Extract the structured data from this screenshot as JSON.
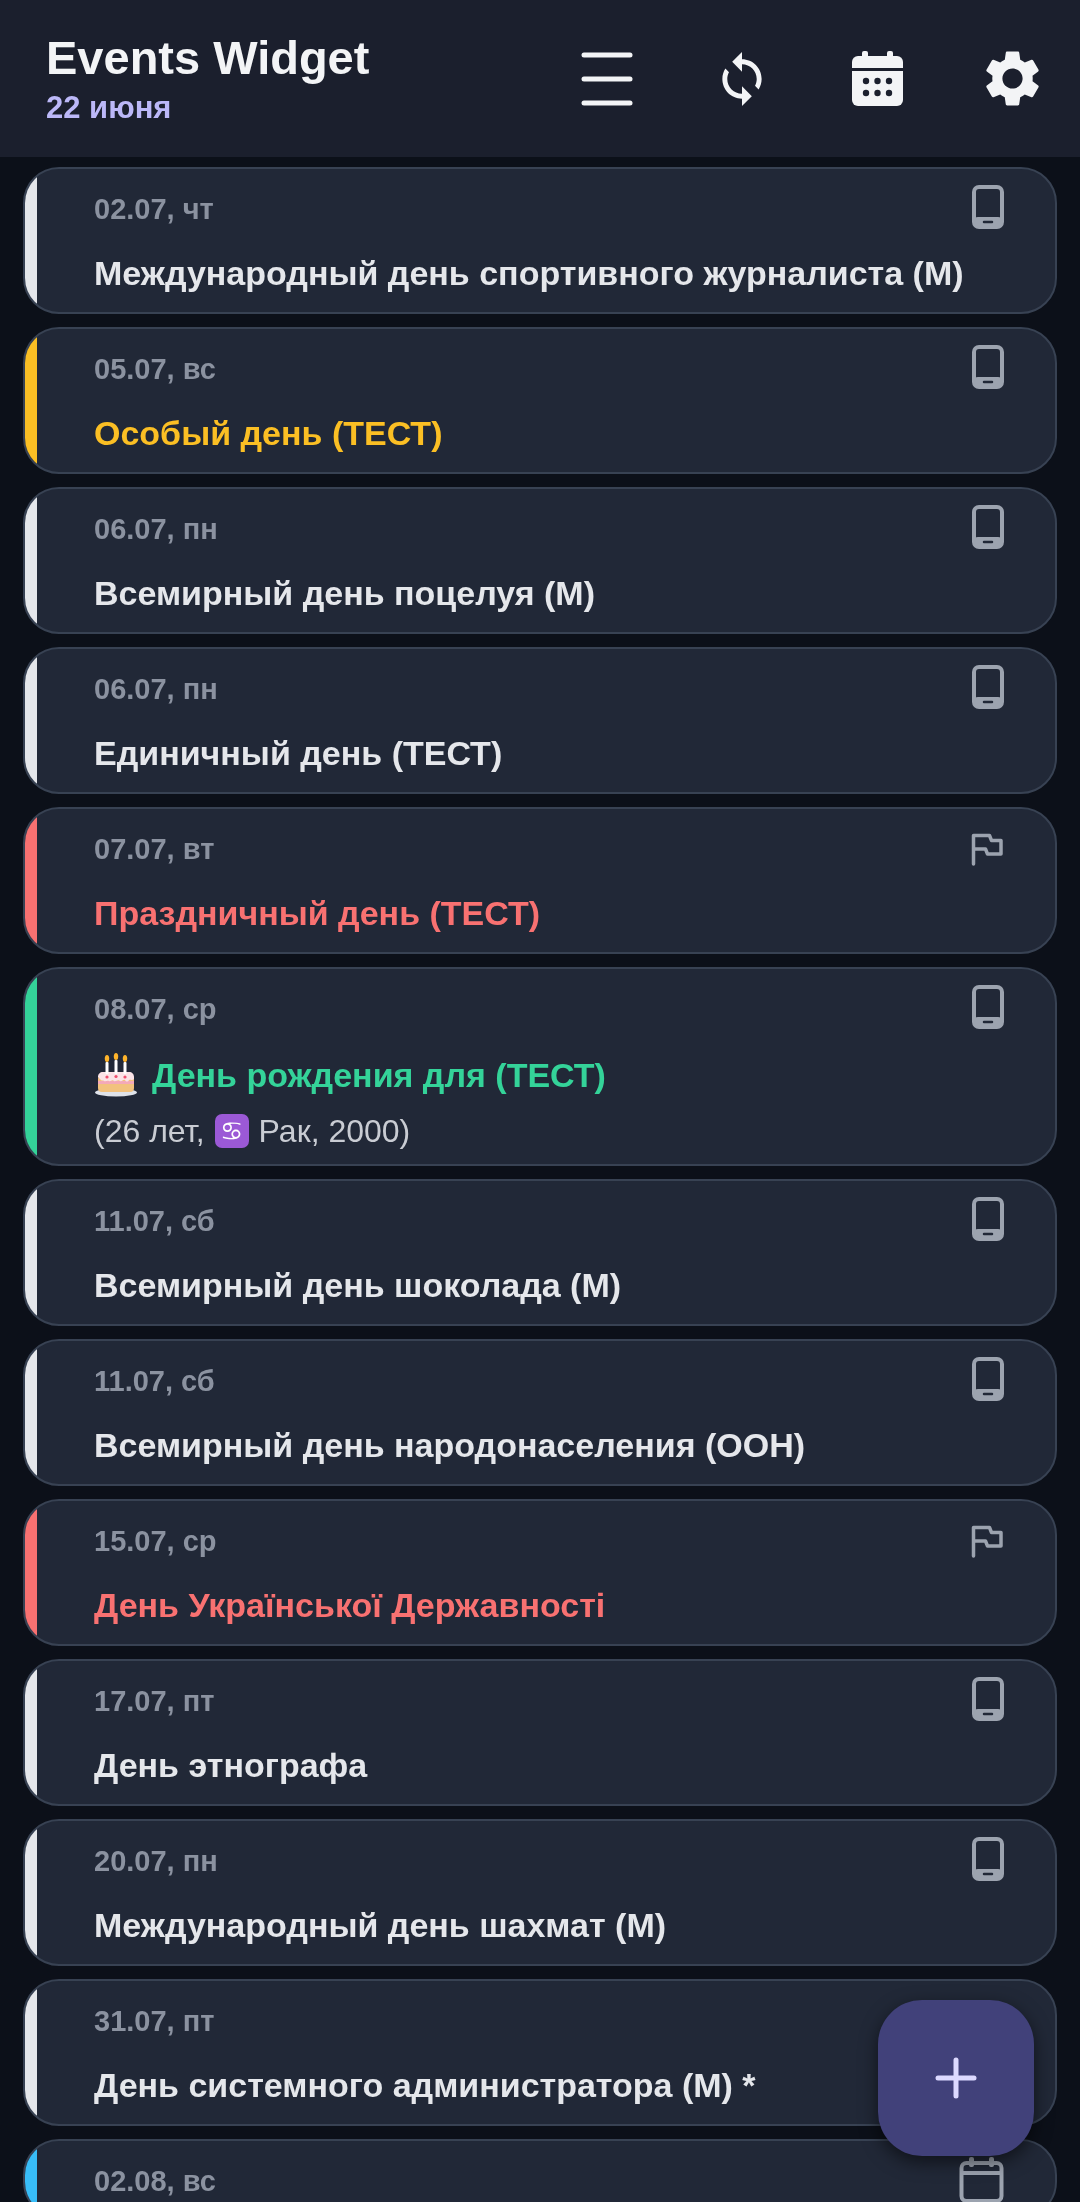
{
  "header": {
    "title": "Events Widget",
    "date": "22 июня"
  },
  "events": [
    {
      "date": "02.07, чт",
      "title": "Международный день спортивного журналиста (М)",
      "color": "#e5e7eb",
      "kind": "device",
      "birthday": false
    },
    {
      "date": "05.07, вс",
      "title": "Особый день (ТЕСТ)",
      "color": "#fbbf24",
      "kind": "device",
      "birthday": false
    },
    {
      "date": "06.07, пн",
      "title": "Всемирный день поцелуя (М)",
      "color": "#e5e7eb",
      "kind": "device",
      "birthday": false
    },
    {
      "date": "06.07, пн",
      "title": "Единичный день (ТЕСТ)",
      "color": "#e5e7eb",
      "kind": "device",
      "birthday": false
    },
    {
      "date": "07.07, вт",
      "title": "Праздничный день (ТЕСТ)",
      "color": "#f87171",
      "kind": "holiday",
      "birthday": false
    },
    {
      "date": "08.07, ср",
      "title": "День рождения для (ТЕСТ)",
      "color": "#34d399",
      "kind": "device",
      "birthday": true,
      "details": [
        {
          "kind": "text",
          "text": "(26 лет,"
        },
        {
          "kind": "sign",
          "text": "♋"
        },
        {
          "kind": "text",
          "text": "Рак, 2000)"
        }
      ]
    },
    {
      "date": "11.07, сб",
      "title": "Всемирный день шоколада (М)",
      "color": "#e5e7eb",
      "kind": "device",
      "birthday": false
    },
    {
      "date": "11.07, сб",
      "title": "Всемирный день народонаселения (ООН)",
      "color": "#e5e7eb",
      "kind": "device",
      "birthday": false
    },
    {
      "date": "15.07, ср",
      "title": "День Української Державності",
      "color": "#f87171",
      "kind": "holiday",
      "birthday": false
    },
    {
      "date": "17.07, пт",
      "title": "День этнографа",
      "color": "#e5e7eb",
      "kind": "device",
      "birthday": false
    },
    {
      "date": "20.07, пн",
      "title": "Международный день шахмат (М)",
      "color": "#e5e7eb",
      "kind": "device",
      "birthday": false
    },
    {
      "date": "31.07, пт",
      "title": "День системного администратора (М) *",
      "color": "#e5e7eb",
      "birthday": false
    },
    {
      "date": "02.08, вс",
      "color": "#38bdf8",
      "kind": "calendar",
      "birthday": false
    }
  ]
}
